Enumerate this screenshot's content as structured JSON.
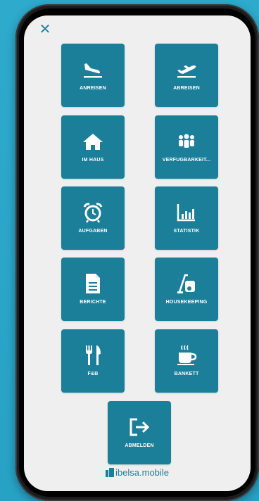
{
  "header": {
    "close_icon": "close-icon",
    "close_glyph": "✕"
  },
  "menu": {
    "anreisen": "ANREISEN",
    "abreisen": "ABREISEN",
    "im_haus": "IM HAUS",
    "verfuegbarkeit": "VERFÜGBARKEIT...",
    "aufgaben": "AUFGABEN",
    "statistik": "STATISTIK",
    "berichte": "BERICHTE",
    "housekeeping": "HOUSEKEEPING",
    "fb": "F&B",
    "bankett": "BANKETT",
    "abmelden": "ABMELDEN"
  },
  "brand": {
    "name_bold": "ibelsa",
    "name_light": ".mobile"
  },
  "colors": {
    "tile": "#1c7f99",
    "screen": "#efefef",
    "background": "#2aa6c9"
  }
}
